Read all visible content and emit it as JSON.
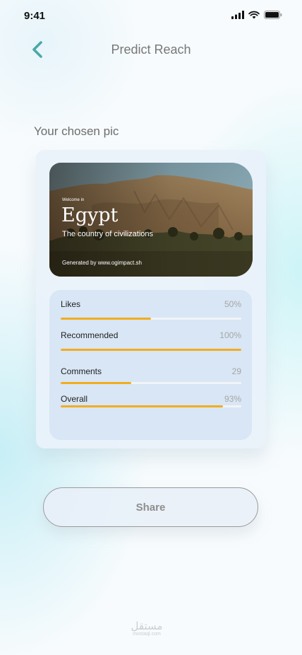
{
  "status_bar": {
    "time": "9:41"
  },
  "header": {
    "title": "Predict Reach",
    "back_icon": "chevron-left-icon",
    "accent": "#4ba8a8"
  },
  "section_title": "Your chosen pic",
  "photo": {
    "welcome": "Welcome in",
    "headline": "Egypt",
    "subtitle": "The country of civilizations",
    "generated": "Generated by www.ogimpact.sh"
  },
  "stats": [
    {
      "label": "Likes",
      "value": "50%",
      "fill": 0.5
    },
    {
      "label": "Recommended",
      "value": "100%",
      "fill": 1.0
    },
    {
      "label": "Comments",
      "value": "29",
      "fill": 0.39
    },
    {
      "label": "Overall",
      "value": "93%",
      "fill": 0.9
    }
  ],
  "colors": {
    "bar_fill": "#f2ad1e",
    "bar_track": "#f2f4f7"
  },
  "share": {
    "label": "Share"
  },
  "watermark": {
    "main": "مستقل",
    "sub": "mostaql.com"
  }
}
